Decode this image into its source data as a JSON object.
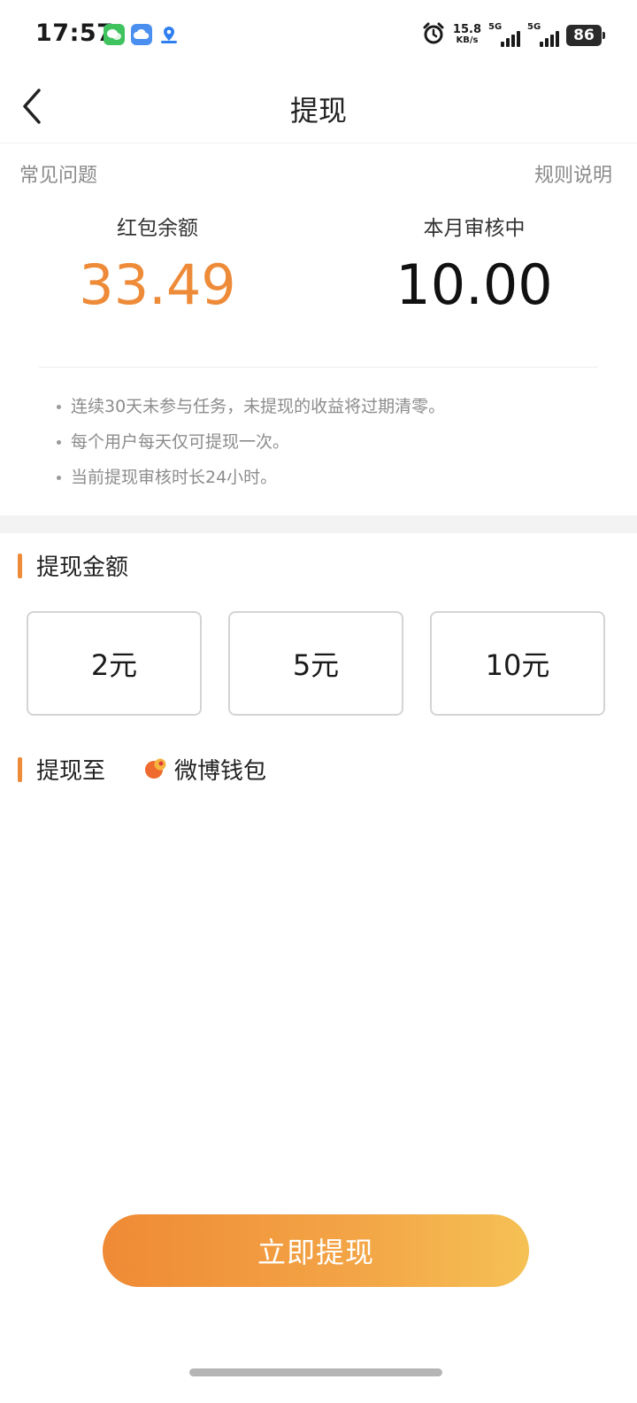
{
  "status_bar": {
    "time": "17:57",
    "apps": [
      "wechat-icon",
      "weather-cloud-icon",
      "map-app-icon"
    ],
    "net_speed": "15.8",
    "net_unit": "KB/s",
    "sim1": "5G",
    "sim2": "5G",
    "battery": "86"
  },
  "nav": {
    "title": "提现",
    "back_icon": "chevron-left-icon"
  },
  "links": {
    "faq": "常见问题",
    "rules": "规则说明"
  },
  "stats": {
    "balance_label": "红包余额",
    "balance_value": "33.49",
    "review_label": "本月审核中",
    "review_value": "10.00"
  },
  "notes": [
    "连续30天未参与任务，未提现的收益将过期清零。",
    "每个用户每天仅可提现一次。",
    "当前提现审核时长24小时。"
  ],
  "amount_section": {
    "title": "提现金额",
    "options": [
      "2元",
      "5元",
      "10元"
    ]
  },
  "destination": {
    "title": "提现至",
    "wallet": "微博钱包"
  },
  "submit_label": "立即提现",
  "colors": {
    "accent": "#ee8b39",
    "gradient_end": "#f5c155"
  }
}
